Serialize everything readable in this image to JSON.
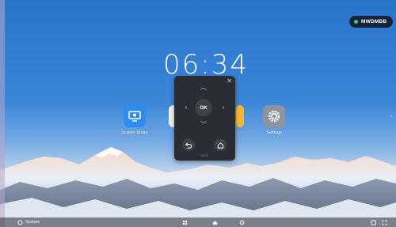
{
  "status": {
    "network_name": "MWDMBB"
  },
  "clock": {
    "time": "06:34"
  },
  "apps": [
    {
      "label": "Screen Share",
      "icon": "screen-share-icon"
    },
    {
      "label": "",
      "icon": "app-icon-hidden"
    },
    {
      "label": "",
      "icon": "app-icon-hidden"
    },
    {
      "label": "Settings",
      "icon": "gear-icon"
    }
  ],
  "remote": {
    "ok_label": "OK",
    "caption": "Back"
  },
  "taskbar": {
    "left_label": "System"
  },
  "colors": {
    "accent": "#2f78cf",
    "remote_bg": "#2a2d33",
    "network_dot": "#2dd36f"
  }
}
